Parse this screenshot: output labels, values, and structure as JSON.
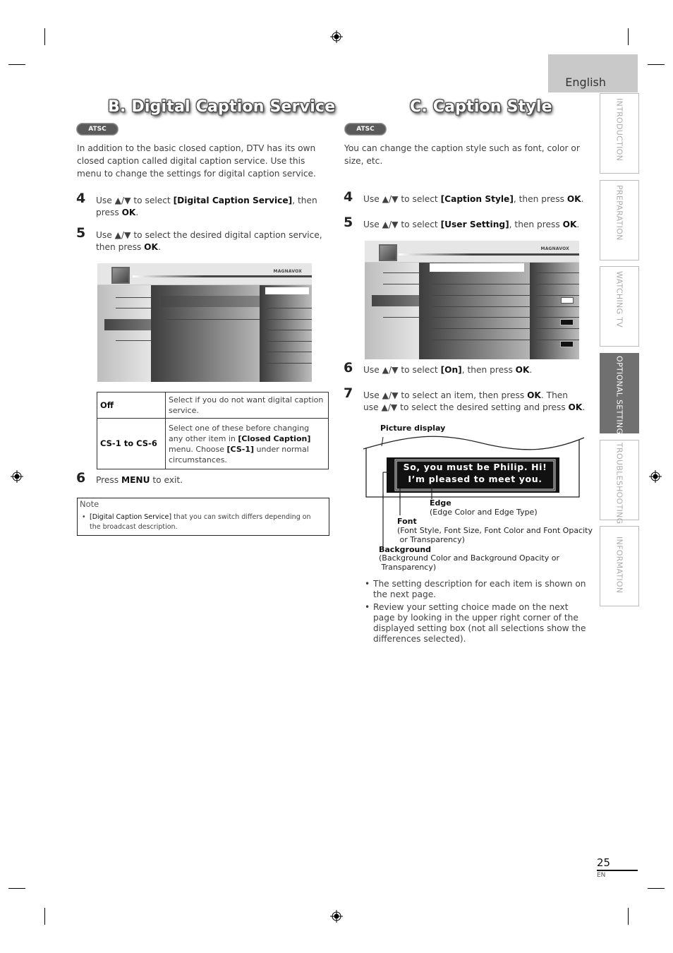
{
  "language_tab": "English",
  "side_tabs": [
    {
      "label": "INTRODUCTION",
      "active": false
    },
    {
      "label": "PREPARATION",
      "active": false
    },
    {
      "label": "WATCHING TV",
      "active": false
    },
    {
      "label": "OPTIONAL SETTING",
      "active": true
    },
    {
      "label": "TROUBLESHOOTING",
      "active": false
    },
    {
      "label": "INFORMATION",
      "active": false
    }
  ],
  "section_b": {
    "title": "B.  Digital Caption Service",
    "badge": "ATSC",
    "intro": "In addition to the basic closed caption, DTV has its own closed caption called digital caption service. Use this menu to change the settings for digital caption service.",
    "steps": [
      {
        "num": "4",
        "pre": "Use ▲/▼ to select ",
        "bold1": "[Digital Caption Service]",
        "mid": ", then press ",
        "bold2": "OK",
        "post": "."
      },
      {
        "num": "5",
        "pre": "Use ▲/▼ to select the desired digital caption service, then press ",
        "bold1": "OK",
        "post": "."
      },
      {
        "num": "6",
        "pre": "Press ",
        "bold1": "MENU",
        "post": " to exit."
      }
    ],
    "menu_brand": "MAGNAVOX",
    "options_table": [
      {
        "key": "Off",
        "desc": "Select if you do not want digital caption service."
      },
      {
        "key": "CS-1 to CS-6",
        "desc_pre": "Select one of these before changing any other item in ",
        "desc_b1": "[Closed Caption]",
        "desc_mid": " menu. Choose ",
        "desc_b2": "[CS-1]",
        "desc_post": " under normal circumstances."
      }
    ],
    "note": {
      "title": "Note",
      "bold": "[Digital Caption Service]",
      "text": " that you can switch differs depending on the broadcast description."
    }
  },
  "section_c": {
    "title": "C.  Caption Style",
    "badge": "ATSC",
    "intro": "You can change the caption style such as font, color or size, etc.",
    "steps": [
      {
        "num": "4",
        "pre": "Use ▲/▼ to select ",
        "bold1": "[Caption Style]",
        "mid": ", then press ",
        "bold2": "OK",
        "post": "."
      },
      {
        "num": "5",
        "pre": "Use ▲/▼ to select ",
        "bold1": "[User Setting]",
        "mid": ", then press ",
        "bold2": "OK",
        "post": "."
      },
      {
        "num": "6",
        "pre": "Use ▲/▼ to select ",
        "bold1": "[On]",
        "mid": ", then press ",
        "bold2": "OK",
        "post": "."
      },
      {
        "num": "7",
        "pre": "Use ▲/▼ to select an item, then press ",
        "bold1": "OK",
        "mid": ". Then use ▲/▼ to select the desired setting and press ",
        "bold2": "OK",
        "post": "."
      }
    ],
    "menu_brand": "MAGNAVOX",
    "diagram": {
      "picture_display": "Picture display",
      "caption_line1": "So, you must be Philip. Hi!",
      "caption_line2": "I’m pleased to meet you.",
      "edge_label": "Edge",
      "edge_desc": "(Edge Color and Edge Type)",
      "font_label": "Font",
      "font_desc1": "(Font Style, Font Size, Font Color and Font Opacity",
      "font_desc2": " or Transparency)",
      "bg_label": "Background",
      "bg_desc1": "(Background Color and Background Opacity or",
      "bg_desc2": " Transparency)"
    },
    "bullets": [
      "The setting description for each item is shown on the next page.",
      "Review your setting choice made on the next page by looking in the upper right corner of the displayed setting box (not all selections show the differences selected)."
    ]
  },
  "footer": {
    "page_number": "25",
    "lang_code": "EN"
  }
}
